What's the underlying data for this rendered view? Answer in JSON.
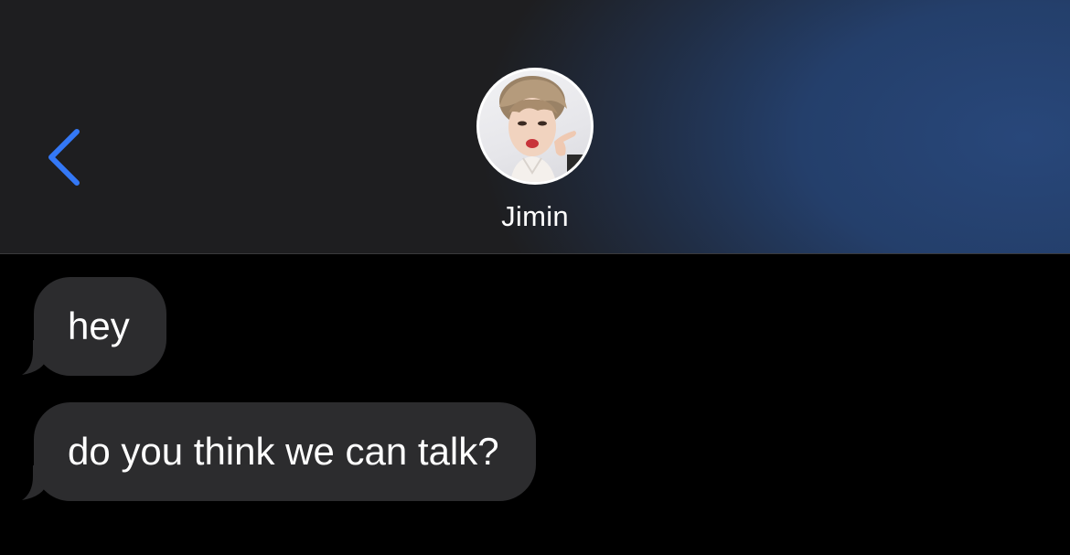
{
  "header": {
    "back_icon": "chevron-left-icon",
    "contact_name": "Jimin",
    "avatar_icon": "contact-photo",
    "accent_color": "#3478f6"
  },
  "conversation": {
    "messages": [
      {
        "direction": "incoming",
        "text": "hey"
      },
      {
        "direction": "incoming",
        "text": "do you think we can talk?"
      }
    ],
    "bubble_color": "#2c2c2e"
  }
}
